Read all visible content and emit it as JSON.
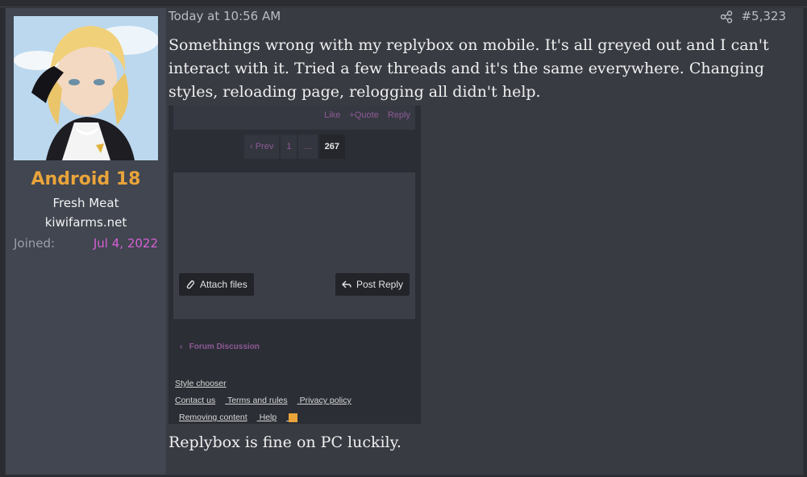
{
  "post": {
    "date": "Today at 10:56 AM",
    "number": "#5,323",
    "message": "Somethings wrong with my replybox on mobile. It's all greyed out and I can't interact with it. Tried a few threads and it's the same everywhere. Changing styles, reloading page, relogging all didn't help.",
    "message_end": "Replybox is fine on PC luckily."
  },
  "user": {
    "name": "Android 18",
    "title": "Fresh Meat",
    "banner": "kiwifarms.net",
    "joined_label": "Joined:",
    "joined_value": "Jul 4, 2022"
  },
  "screenshot": {
    "actions": [
      "Like",
      "+Quote",
      "Reply"
    ],
    "pager": [
      "‹ Prev",
      "1",
      "...",
      "267"
    ],
    "attach_label": "Attach files",
    "post_reply_label": "Post Reply",
    "breadcrumb": "Forum Discussion",
    "footer_row1": [
      "Style chooser"
    ],
    "footer_row2": [
      "Contact us",
      "Terms and rules",
      "Privacy policy"
    ],
    "footer_row3": [
      "Removing content",
      "Help"
    ]
  },
  "colors": {
    "username": "#e9a43a",
    "joined_date": "#d85fd8",
    "accent_purple": "#8e5a96"
  }
}
